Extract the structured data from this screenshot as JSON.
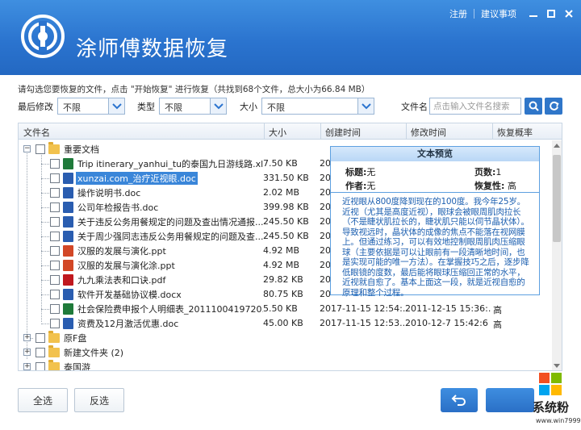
{
  "app": {
    "title": "涂师傅数据恢复"
  },
  "topbar": {
    "register": "注册",
    "feedback": "建议事项"
  },
  "info_line": "请勾选您要恢复的文件，点击 \"开始恢复\" 进行恢复（共找到68个文件，总大小为66.84 MB）",
  "filters": {
    "modified_label": "最后修改",
    "modified_value": "不限",
    "type_label": "类型",
    "type_value": "不限",
    "size_label": "大小",
    "size_value": "不限",
    "filename_label": "文件名",
    "filename_placeholder": "点击输入文件名搜索"
  },
  "table": {
    "columns": [
      "文件名",
      "大小",
      "创建时间",
      "修改时间",
      "恢复概率"
    ],
    "folder_root": "重要文档",
    "files": [
      {
        "name": "Trip itinerary_yanhui_tu的泰国九日游线路.xls",
        "size": "7.50 KB",
        "created": "20",
        "modified": "",
        "prob": "",
        "icon": "excel-icon"
      },
      {
        "name": "xunzai.com_治疗近视眼.doc",
        "size": "331.50 KB",
        "created": "20",
        "modified": "",
        "prob": "",
        "icon": "word-icon"
      },
      {
        "name": "操作说明书.doc",
        "size": "2.02 MB",
        "created": "20",
        "modified": "",
        "prob": "",
        "icon": "word-icon"
      },
      {
        "name": "公司年检报告书.doc",
        "size": "399.98 KB",
        "created": "20",
        "modified": "",
        "prob": "",
        "icon": "word-icon"
      },
      {
        "name": "关于违反公务用餐规定的问题及查出情况通报...",
        "size": "245.50 KB",
        "created": "20",
        "modified": "",
        "prob": "",
        "icon": "word-icon"
      },
      {
        "name": "关于周少强同志违反公务用餐规定的问题及查...",
        "size": "245.50 KB",
        "created": "20",
        "modified": "",
        "prob": "",
        "icon": "word-icon"
      },
      {
        "name": "汉服的发展与演化.ppt",
        "size": "4.92 MB",
        "created": "20",
        "modified": "",
        "prob": "",
        "icon": "ppt-icon"
      },
      {
        "name": "汉服的发展与演化涂.ppt",
        "size": "4.92 MB",
        "created": "20",
        "modified": "",
        "prob": "",
        "icon": "ppt-icon"
      },
      {
        "name": "九九乘法表和口诀.pdf",
        "size": "29.82 KB",
        "created": "20",
        "modified": "",
        "prob": "",
        "icon": "pdf-icon"
      },
      {
        "name": "软件开发基础协议模.docx",
        "size": "80.75 KB",
        "created": "20",
        "modified": "",
        "prob": "",
        "icon": "word-icon"
      },
      {
        "name": "社会保险费申报个人明细表_2011100419720...",
        "size": "5.50 KB",
        "created": "2017-11-15 12:54:...",
        "modified": "2011-12-15 15:36:...",
        "prob": "高",
        "icon": "excel-icon"
      },
      {
        "name": "资费及12月激活优惠.doc",
        "size": "45.00 KB",
        "created": "2017-11-15 12:53...",
        "modified": "2010-12-7 15:42:6",
        "prob": "高",
        "icon": "word-icon"
      }
    ],
    "other_folders": [
      "原F盘",
      "新建文件夹 (2)",
      "泰国游"
    ]
  },
  "preview": {
    "title": "文本预览",
    "title_label": "标题:",
    "title_value": "无",
    "pages_label": "页数:",
    "pages_value": "1",
    "author_label": "作者:",
    "author_value": "无",
    "recover_label": "恢复性:",
    "recover_value": "高",
    "content": "近视眼从800度降到现在的100度。我今年25岁。近视（尤其是高度近视），眼球会被眼周肌肉拉长（不是睫状肌拉长的，睫状肌只能以伺节晶状体）。导致视远时，晶状体的成像的焦点不能落在视网膜上。但通过练习，可以有效地控制眼周肌肉压缩眼球（主要依据是可以让眼前有一段清晰地时间，也是实现可能的唯一方法）。在掌握技巧之后，逐步降低眼镜的度数，最后能将眼球压缩回正常的水平，近视就自愈了。基本上面这一段，就是近视自愈的原理和整个过程。"
  },
  "buttons": {
    "select_all": "全选",
    "invert": "反选"
  },
  "watermark": {
    "text": "系统粉",
    "url": "www.win7999.com"
  }
}
